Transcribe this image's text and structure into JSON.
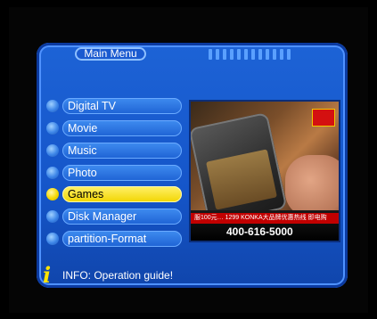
{
  "header": {
    "title": "Main Menu"
  },
  "menu": {
    "items": [
      {
        "label": "Digital TV"
      },
      {
        "label": "Movie"
      },
      {
        "label": "Music"
      },
      {
        "label": "Photo"
      },
      {
        "label": "Games"
      },
      {
        "label": "Disk Manager"
      },
      {
        "label": "partition-Format"
      }
    ],
    "selected_index": 4
  },
  "preview": {
    "ticker_line1": "服100元…  1299 KONKA大品牌优惠热线  即电购",
    "ticker_line2": "400-616-5000"
  },
  "info": {
    "icon": "info-icon",
    "text": "INFO: Operation guide!"
  },
  "colors": {
    "panel": "#1555c9",
    "highlight": "#f2d500",
    "info_icon": "#ffe400"
  }
}
